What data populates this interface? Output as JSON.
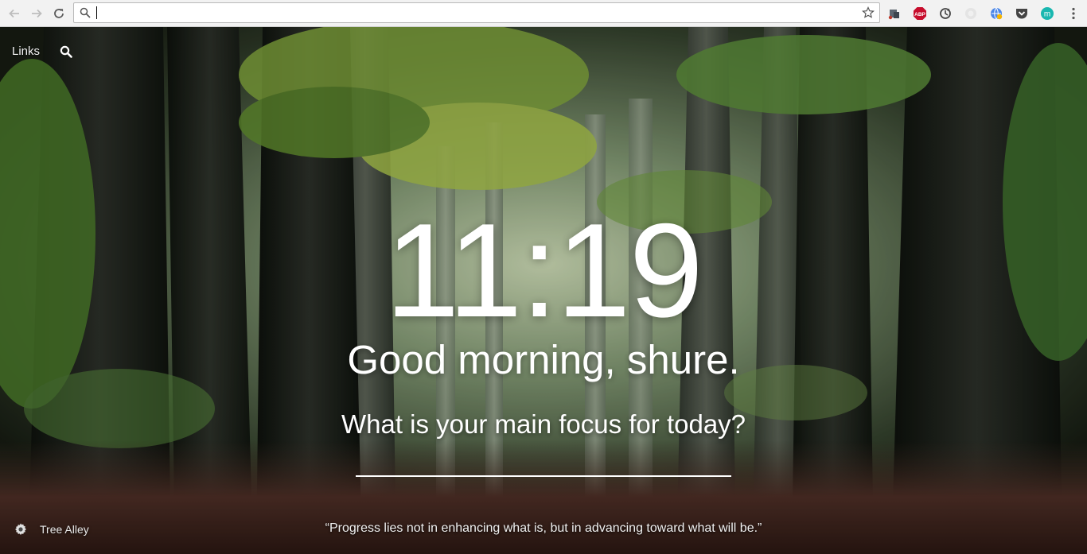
{
  "browser": {
    "omnibox": {
      "value": "",
      "placeholder": ""
    },
    "extensions": [
      {
        "icon": "puzzle-extension-icon"
      },
      {
        "icon": "adblock-plus-icon",
        "label": "ABP",
        "color": "#c70d2c"
      },
      {
        "icon": "sync-refresh-icon"
      },
      {
        "icon": "disabled-extension-icon"
      },
      {
        "icon": "translate-globe-icon"
      },
      {
        "icon": "pocket-icon"
      },
      {
        "icon": "momentum-icon",
        "label": "m",
        "color": "#19b7b0"
      }
    ]
  },
  "momentum": {
    "links_label": "Links",
    "time": "11:19",
    "greeting": "Good morning, shure.",
    "focus_question": "What is your main focus for today?",
    "focus_value": "",
    "photo_credit": "Tree Alley",
    "quote": "“Progress lies not in enhancing what is, but in advancing toward what will be.”"
  },
  "colors": {
    "chrome_bg": "#f2f2f2",
    "text_white": "#ffffff",
    "forest_dark": "#1a2116",
    "foliage": "#7fa23c"
  }
}
